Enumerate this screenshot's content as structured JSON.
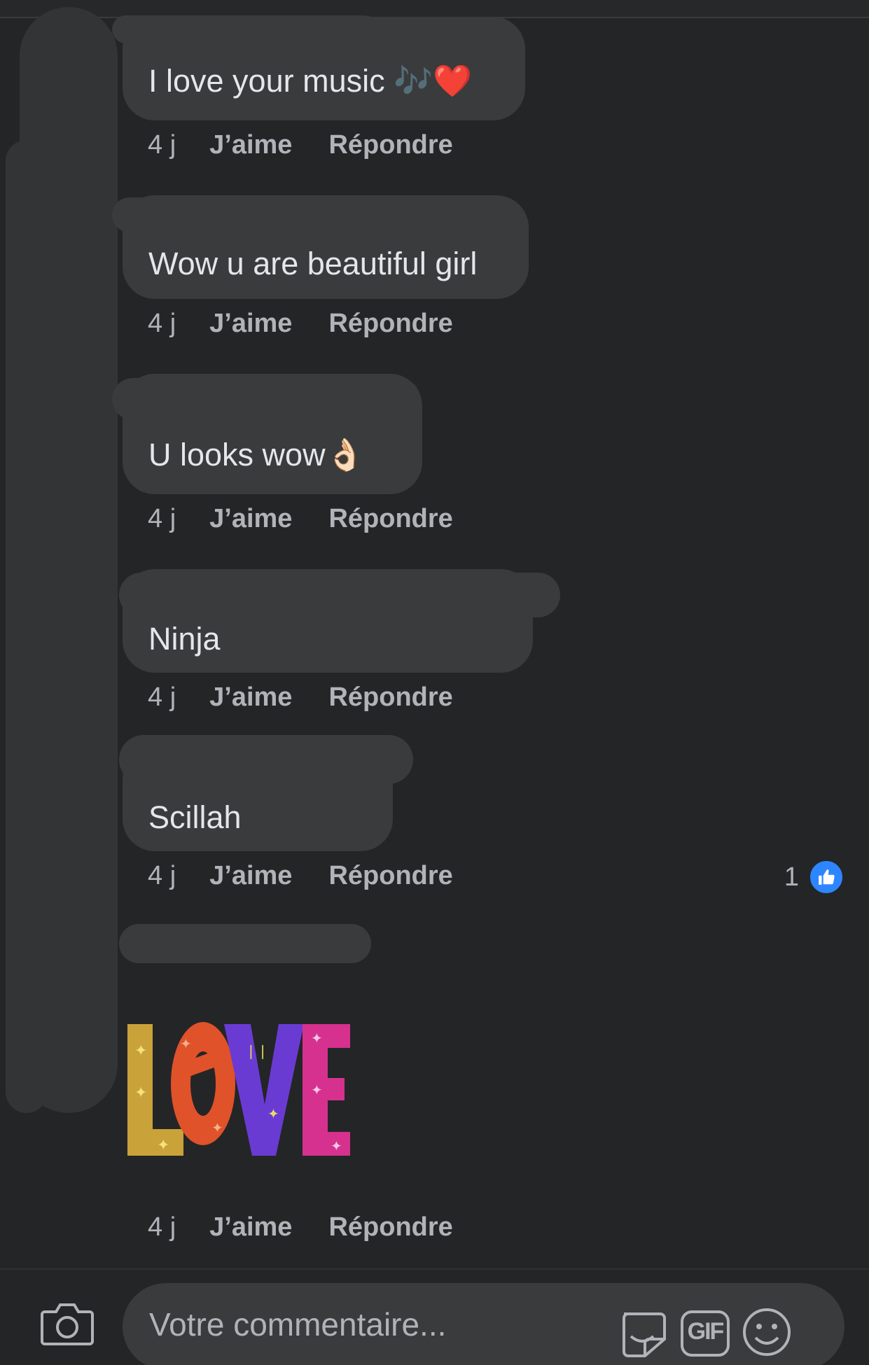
{
  "comments": [
    {
      "text": "I love your music 🎶❤️",
      "time": "4 j",
      "like_label": "J’aime",
      "reply_label": "Répondre"
    },
    {
      "text": "Wow u are beautiful girl",
      "time": "4 j",
      "like_label": "J’aime",
      "reply_label": "Répondre"
    },
    {
      "text": "U looks wow👌🏻",
      "time": "4 j",
      "like_label": "J’aime",
      "reply_label": "Répondre"
    },
    {
      "text": "Ninja",
      "time": "4 j",
      "like_label": "J’aime",
      "reply_label": "Répondre"
    },
    {
      "text": "Scillah",
      "time": "4 j",
      "like_label": "J’aime",
      "reply_label": "Répondre",
      "reaction_count": "1"
    },
    {
      "sticker": "love-sticker",
      "time": "4 j",
      "like_label": "J’aime",
      "reply_label": "Répondre"
    }
  ],
  "sticker_letters": [
    "L",
    "O",
    "V",
    "E"
  ],
  "composer": {
    "placeholder": "Votre commentaire...",
    "gif_label": "GIF"
  },
  "colors": {
    "background": "#242526",
    "bubble": "#3a3b3c",
    "meta_text": "#b0b3b8",
    "like_blue": "#2d86ff"
  },
  "icons": [
    "camera-icon",
    "sticker-icon",
    "gif-icon",
    "emoji-icon",
    "thumbs-up-icon"
  ]
}
